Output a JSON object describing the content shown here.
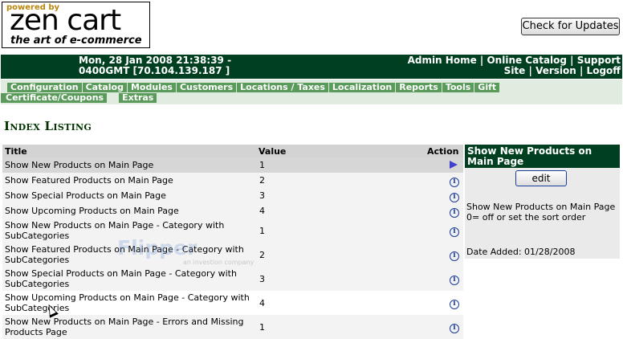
{
  "logo": {
    "powered": "powered by",
    "brand": "zen cart",
    "tagline": "the art of e-commerce"
  },
  "check_updates": "Check for Updates",
  "header": {
    "date_line1": "Mon, 28 Jan 2008 21:38:39 -",
    "date_line2": "0400GMT [70.104.139.187 ]",
    "links_row1": [
      "Admin Home",
      "Online Catalog",
      "Support"
    ],
    "links_row2": [
      "Site",
      "Version",
      "Logoff"
    ]
  },
  "menu": {
    "row1": [
      "Configuration",
      "Catalog",
      "Modules",
      "Customers",
      "Locations / Taxes",
      "Localization",
      "Reports",
      "Tools",
      "Gift"
    ],
    "row2": [
      "Certificate/Coupons",
      "Extras"
    ]
  },
  "page_title": "Index Listing",
  "table": {
    "headers": {
      "title": "Title",
      "value": "Value",
      "action": "Action"
    },
    "rows": [
      {
        "title": "Show New Products on Main Page",
        "value": "1",
        "action": "selected-arrow"
      },
      {
        "title": "Show Featured Products on Main Page",
        "value": "2",
        "action": "info-icon"
      },
      {
        "title": "Show Special Products on Main Page",
        "value": "3",
        "action": "info-icon"
      },
      {
        "title": "Show Upcoming Products on Main Page",
        "value": "4",
        "action": "info-icon"
      },
      {
        "title": "Show New Products on Main Page - Category with SubCategories",
        "value": "1",
        "action": "info-icon"
      },
      {
        "title": "Show Featured Products on Main Page - Category with SubCategories",
        "value": "2",
        "action": "info-icon"
      },
      {
        "title": "Show Special Products on Main Page - Category with SubCategories",
        "value": "3",
        "action": "info-icon"
      },
      {
        "title": "Show Upcoming Products on Main Page - Category with SubCategories",
        "value": "4",
        "action": "info-icon"
      },
      {
        "title": "Show New Products on Main Page - Errors and Missing Products Page",
        "value": "1",
        "action": "info-icon"
      }
    ]
  },
  "side": {
    "heading": "Show New Products on Main Page",
    "edit_label": "edit",
    "description": "Show New Products on Main Page",
    "description2": "0= off or set the sort order",
    "date_added": "Date Added: 01/28/2008"
  },
  "watermark": {
    "text": "Flipper",
    "sub": "an investion company"
  },
  "colors": {
    "header_bg": "#004020",
    "menu_item_bg": "#5a9a5a",
    "title_color": "#003300"
  }
}
